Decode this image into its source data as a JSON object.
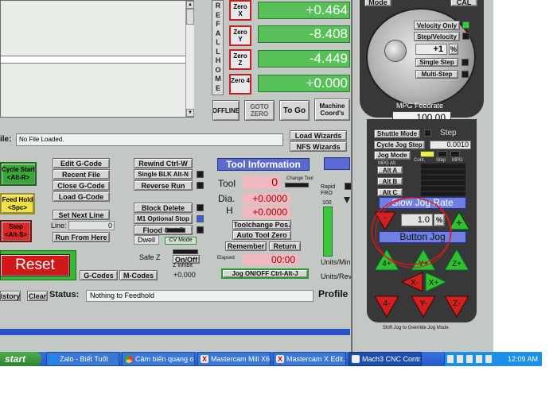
{
  "dro": {
    "axes": [
      {
        "label": "Zero X",
        "value": "+0.464"
      },
      {
        "label": "Zero Y",
        "value": "-8.408"
      },
      {
        "label": "Zero Z",
        "value": "-4.449"
      },
      {
        "label": "Zero 4",
        "value": "+0.000"
      }
    ],
    "ref_all_home": [
      "R",
      "E",
      "F",
      "A",
      "L",
      "L",
      "H",
      "O",
      "M",
      "E"
    ],
    "offline": "OFFLINE",
    "goto_zero": "GOTO ZERO",
    "to_go": "To Go",
    "machine_coords": "Machine Coord's"
  },
  "file": {
    "label": "ile:",
    "value": "No File Loaded.",
    "load_wizards": "Load Wizards",
    "nfs_wizards": "NFS Wizards"
  },
  "left_controls": {
    "cycle_start": "Cycle Start <Alt-R>",
    "feed_hold": "Feed Hold <Spc>",
    "stop": "Stop <Alt-S>",
    "reset": "Reset"
  },
  "gcode": {
    "edit": "Edit G-Code",
    "recent": "Recent File",
    "close": "Close G-Code",
    "load": "Load G-Code",
    "set_next": "Set Next Line",
    "line_label": "Line:",
    "line_value": "0",
    "run_from_here": "Run From Here",
    "gcodes": "G-Codes",
    "mcodes": "M-Codes"
  },
  "rewind": {
    "rewind": "Rewind Ctrl-W",
    "single_blk": "Single BLK Alt-N",
    "reverse_run": "Reverse Run",
    "block_delete": "Block Delete",
    "m1_optional": "M1 Optional Stop",
    "flood": "Flood Ctrl-F",
    "dwell": "Dwell",
    "cv_mode": "CV Mode",
    "safe_z": "Safe Z",
    "on_off": "On/Off",
    "z_inhibit": "Z Inhibit",
    "z_value": "+0.000"
  },
  "tool": {
    "title": "Tool Information",
    "tool_label": "Tool",
    "tool_value": "0",
    "change_label": "Change Tool",
    "dia_label": "Dia.",
    "dia_value": "+0.0000",
    "h_label": "H",
    "h_value": "+0.0000",
    "toolchange_pos": "Toolchange Pos.",
    "auto_tool_zero": "Auto Tool Zero",
    "remember": "Remember",
    "return": "Return",
    "elapsed_label": "Elapsed",
    "elapsed_value": "00:00",
    "jog_toggle": "Jog ON/OFF Ctrl-Alt-J"
  },
  "feed": {
    "rapid_label": "Rapid FRO",
    "rapid_value": "100",
    "units_min": "Units/Min",
    "units_rev": "Units/Rev",
    "profile": "Profile"
  },
  "status": {
    "history": "istory",
    "clear": "Clear",
    "label": "Status:",
    "value": "Nothing to Feedhold"
  },
  "mpg": {
    "mode": "Mode",
    "cal": "CAL",
    "velocity_only": "Velocity Only",
    "step_velocity": "Step/Velocity",
    "multiplier": "+1",
    "pct": "%",
    "single_step": "Single Step",
    "multi_step": "Multi-Step",
    "feedrate_label": "MPG Feedrate",
    "feedrate_value": "100.00"
  },
  "jog": {
    "shuttle_mode": "Shuttle Mode",
    "step_label": "Step",
    "cycle_jog_step": "Cycle Jog Step",
    "step_value": "0.0010",
    "jog_mode": "Jog Mode",
    "cont": "Cont.",
    "step_col": "Step",
    "mpg_col": "MPG",
    "mpg_alt": "MPG Alt",
    "alt_a": "Alt A",
    "alt_b": "Alt B",
    "alt_c": "Alt C",
    "slow_jog_rate": "Slow Jog Rate",
    "jog_rate_value": "1.0",
    "button_jog": "Button Jog",
    "buttons": [
      "4+",
      "Y+",
      "Z+",
      "X-",
      "X+",
      "4-",
      "Y-",
      "Z-"
    ],
    "minus": "-",
    "plus": "+",
    "shift_note": "Shift Jog to Override Jog Mode"
  },
  "taskbar": {
    "start": "start",
    "tasks": [
      "Zalo - Biết Tuốt",
      "Cảm biến quang o...",
      "Mastercam Mill X6...",
      "Mastercam X Edit...",
      "Mach3 CNC Contr..."
    ],
    "clock": "12:09 AM"
  },
  "colors": {
    "panel": "#c4c8c4",
    "dro_green": "#58c058",
    "reset_red": "#d01818",
    "taskbar_blue": "#2459c8",
    "start_green": "#3c9a3c",
    "annotation_red": "#e01818"
  }
}
